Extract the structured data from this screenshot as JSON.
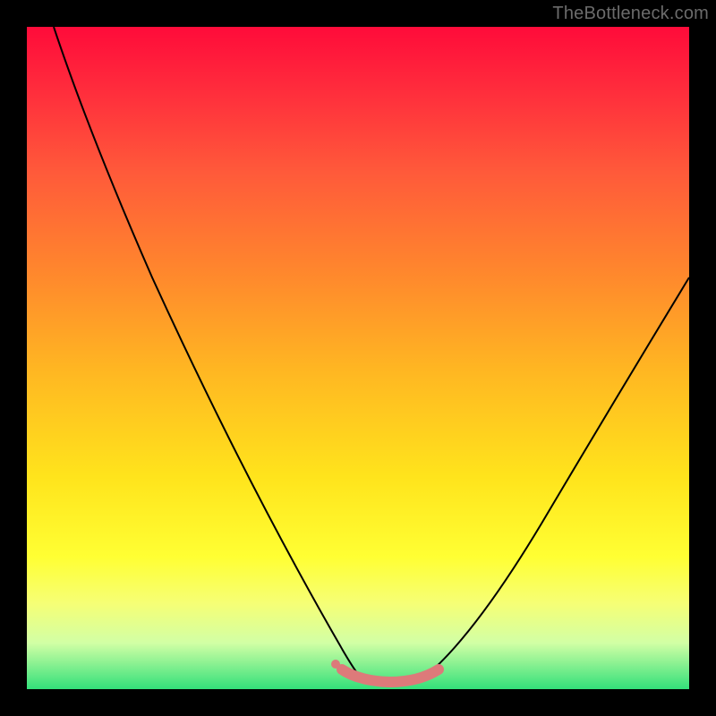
{
  "watermark": "TheBottleneck.com",
  "chart_data": {
    "type": "line",
    "title": "",
    "xlabel": "",
    "ylabel": "",
    "xlim": [
      0,
      100
    ],
    "ylim": [
      0,
      100
    ],
    "gradient_stops": [
      {
        "pos": 0,
        "color": "#ff0b3a"
      },
      {
        "pos": 10,
        "color": "#ff2e3c"
      },
      {
        "pos": 22,
        "color": "#ff5a3a"
      },
      {
        "pos": 38,
        "color": "#ff8a2c"
      },
      {
        "pos": 52,
        "color": "#ffb722"
      },
      {
        "pos": 68,
        "color": "#ffe41c"
      },
      {
        "pos": 80,
        "color": "#ffff33"
      },
      {
        "pos": 87,
        "color": "#f6ff75"
      },
      {
        "pos": 93,
        "color": "#d2ffa5"
      },
      {
        "pos": 100,
        "color": "#33e07a"
      }
    ],
    "series": [
      {
        "name": "left-branch",
        "color": "#000000",
        "stroke_width": 2,
        "points": [
          {
            "x": 4,
            "y": 100
          },
          {
            "x": 7,
            "y": 92
          },
          {
            "x": 11,
            "y": 83
          },
          {
            "x": 16,
            "y": 72
          },
          {
            "x": 22,
            "y": 58
          },
          {
            "x": 30,
            "y": 41
          },
          {
            "x": 38,
            "y": 24
          },
          {
            "x": 44,
            "y": 11
          },
          {
            "x": 48,
            "y": 4
          },
          {
            "x": 50,
            "y": 2
          }
        ]
      },
      {
        "name": "right-branch",
        "color": "#000000",
        "stroke_width": 2,
        "points": [
          {
            "x": 60,
            "y": 2
          },
          {
            "x": 63,
            "y": 5
          },
          {
            "x": 68,
            "y": 12
          },
          {
            "x": 74,
            "y": 22
          },
          {
            "x": 81,
            "y": 33
          },
          {
            "x": 88,
            "y": 44
          },
          {
            "x": 94,
            "y": 53
          },
          {
            "x": 100,
            "y": 62
          }
        ]
      },
      {
        "name": "bottom-sweet-spot",
        "color": "#dd7a7a",
        "stroke_width": 10,
        "points": [
          {
            "x": 48,
            "y": 2.8
          },
          {
            "x": 50,
            "y": 1.6
          },
          {
            "x": 53,
            "y": 1.0
          },
          {
            "x": 56,
            "y": 1.0
          },
          {
            "x": 59,
            "y": 1.4
          },
          {
            "x": 62,
            "y": 3.0
          }
        ]
      }
    ],
    "marker": {
      "name": "marker-dot",
      "x": 47,
      "y": 3.7,
      "r": 5,
      "color": "#dd7a7a"
    }
  }
}
